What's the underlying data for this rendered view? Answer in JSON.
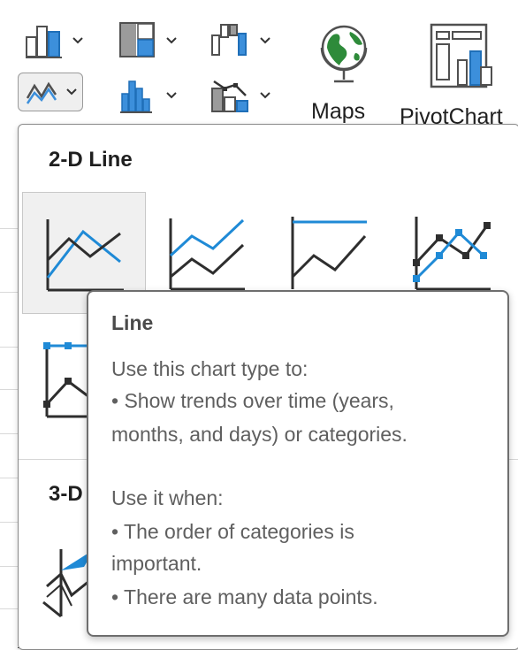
{
  "ribbon": {
    "buttons": [
      {
        "name": "column-chart-button",
        "icon": "clustered-column-icon"
      },
      {
        "name": "hierarchy-chart-button",
        "icon": "treemap-icon"
      },
      {
        "name": "waterfall-chart-button",
        "icon": "waterfall-icon"
      },
      {
        "name": "line-chart-button",
        "icon": "line-chart-icon",
        "selected": true
      },
      {
        "name": "statistic-chart-button",
        "icon": "histogram-icon"
      },
      {
        "name": "combo-chart-button",
        "icon": "combo-chart-icon"
      }
    ],
    "maps_label": "Maps",
    "pivotchart_label": "PivotChart"
  },
  "gallery": {
    "section_2d": "2-D Line",
    "section_3d": "3-D",
    "thumbnails_2d": [
      "Line",
      "Stacked Line",
      "100% Stacked Line",
      "Line with Markers",
      "Stacked Line with Markers"
    ],
    "colors": {
      "accent": "#1f8ad6",
      "dark": "#3c3c3c",
      "marker_dark": "#2e2e2e"
    }
  },
  "tooltip": {
    "title": "Line",
    "lines": [
      "Use this chart type to:",
      "• Show trends over time (years,",
      "months, and days) or categories.",
      "",
      "Use it when:",
      "• The order of categories is",
      "important.",
      "• There are many data points."
    ]
  }
}
